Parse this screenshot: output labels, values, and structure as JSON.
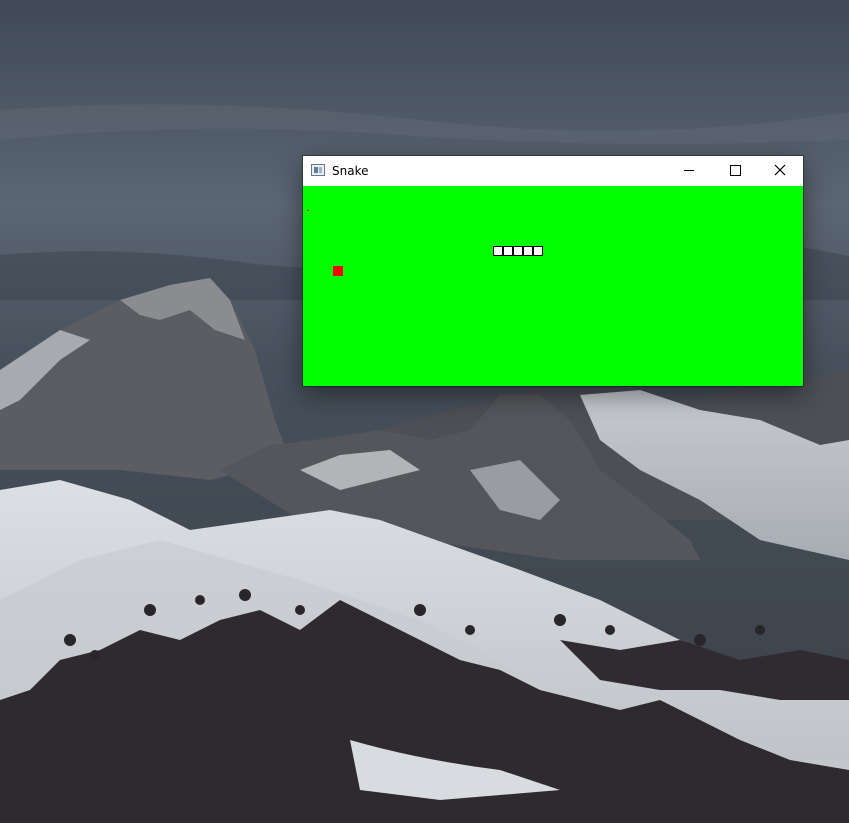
{
  "window": {
    "title": "Snake",
    "icon": "app-window-icon",
    "controls": {
      "minimize": "minimize-icon",
      "maximize": "maximize-icon",
      "close": "close-icon"
    }
  },
  "game": {
    "background_color": "#00ff00",
    "food_color": "#ff0000",
    "snake_body_color": "#ffffff",
    "snake_outline_color": "#000000",
    "snake_segments": 5
  }
}
